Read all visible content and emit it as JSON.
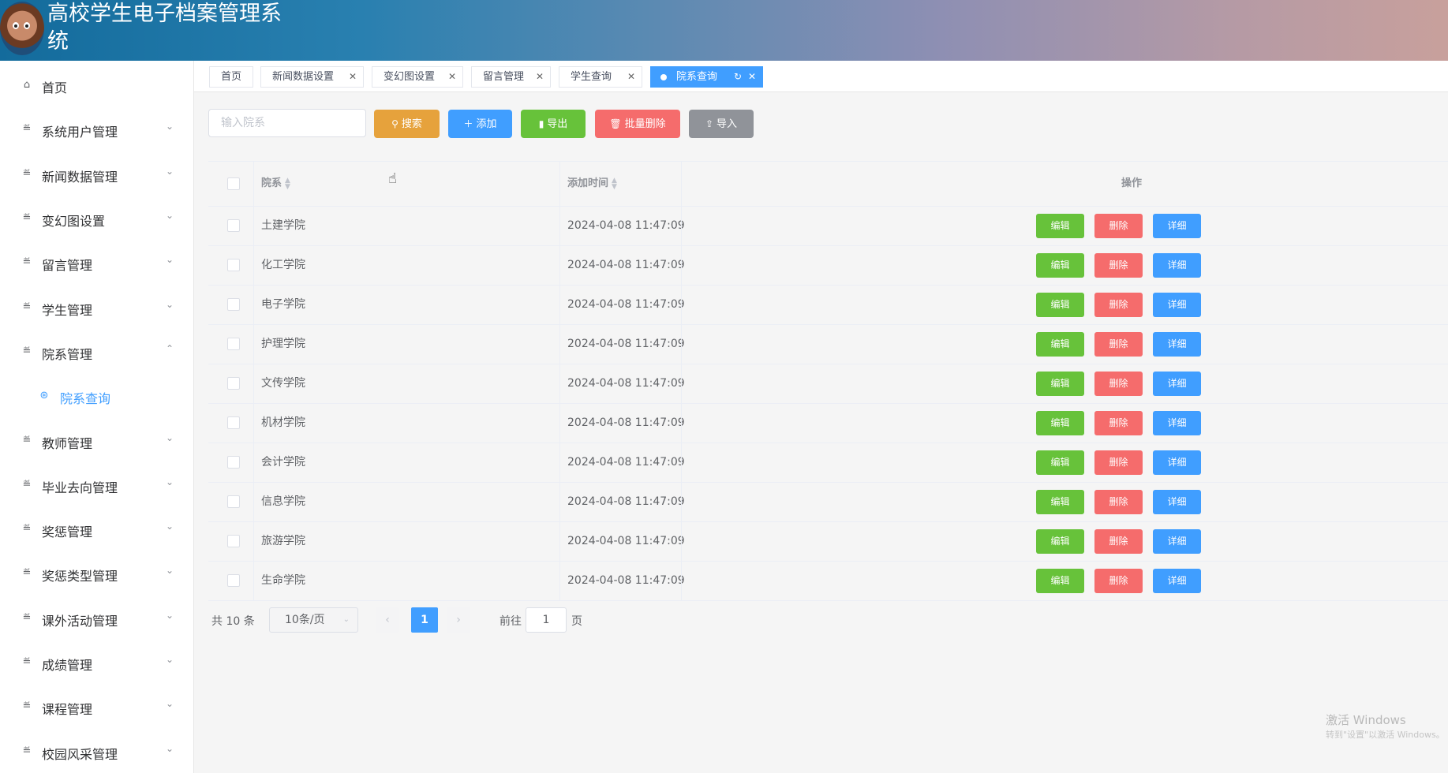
{
  "header": {
    "title": "高校学生电子档案管理系统"
  },
  "sidebar": {
    "items": [
      {
        "label": "首页",
        "icon": "home-icon",
        "arrow": ""
      },
      {
        "label": "系统用户管理",
        "icon": "menu-icon",
        "arrow": "⌄"
      },
      {
        "label": "新闻数据管理",
        "icon": "menu-icon",
        "arrow": "⌄"
      },
      {
        "label": "变幻图设置",
        "icon": "menu-icon",
        "arrow": "⌄"
      },
      {
        "label": "留言管理",
        "icon": "menu-icon",
        "arrow": "⌄"
      },
      {
        "label": "学生管理",
        "icon": "menu-icon",
        "arrow": "⌄"
      },
      {
        "label": "院系管理",
        "icon": "menu-icon",
        "arrow": "⌃"
      },
      {
        "label": "院系查询",
        "icon": "basketball-icon",
        "arrow": ""
      },
      {
        "label": "教师管理",
        "icon": "menu-icon",
        "arrow": "⌄"
      },
      {
        "label": "毕业去向管理",
        "icon": "menu-icon",
        "arrow": "⌄"
      },
      {
        "label": "奖惩管理",
        "icon": "menu-icon",
        "arrow": "⌄"
      },
      {
        "label": "奖惩类型管理",
        "icon": "menu-icon",
        "arrow": "⌄"
      },
      {
        "label": "课外活动管理",
        "icon": "menu-icon",
        "arrow": "⌄"
      },
      {
        "label": "成绩管理",
        "icon": "menu-icon",
        "arrow": "⌄"
      },
      {
        "label": "课程管理",
        "icon": "menu-icon",
        "arrow": "⌄"
      },
      {
        "label": "校园风采管理",
        "icon": "menu-icon",
        "arrow": "⌄"
      }
    ]
  },
  "tabs": [
    {
      "label": "首页",
      "closable": false,
      "active": false
    },
    {
      "label": "新闻数据设置",
      "closable": true,
      "active": false
    },
    {
      "label": "变幻图设置",
      "closable": true,
      "active": false
    },
    {
      "label": "留言管理",
      "closable": true,
      "active": false
    },
    {
      "label": "学生查询",
      "closable": true,
      "active": false
    },
    {
      "label": "院系查询",
      "closable": true,
      "active": true
    }
  ],
  "toolbar": {
    "search_placeholder": "输入院系",
    "search_label": "搜索",
    "add_label": "添加",
    "export_label": "导出",
    "batch_delete_label": "批量删除",
    "import_label": "导入"
  },
  "table": {
    "headers": {
      "dept": "院系",
      "time": "添加时间",
      "ops": "操作"
    },
    "rows": [
      {
        "dept": "土建学院",
        "time": "2024-04-08 11:47:09"
      },
      {
        "dept": "化工学院",
        "time": "2024-04-08 11:47:09"
      },
      {
        "dept": "电子学院",
        "time": "2024-04-08 11:47:09"
      },
      {
        "dept": "护理学院",
        "time": "2024-04-08 11:47:09"
      },
      {
        "dept": "文传学院",
        "time": "2024-04-08 11:47:09"
      },
      {
        "dept": "机材学院",
        "time": "2024-04-08 11:47:09"
      },
      {
        "dept": "会计学院",
        "time": "2024-04-08 11:47:09"
      },
      {
        "dept": "信息学院",
        "time": "2024-04-08 11:47:09"
      },
      {
        "dept": "旅游学院",
        "time": "2024-04-08 11:47:09"
      },
      {
        "dept": "生命学院",
        "time": "2024-04-08 11:47:09"
      }
    ],
    "ops": {
      "edit": "编辑",
      "delete": "删除",
      "detail": "详细"
    }
  },
  "pagination": {
    "total": "共 10 条",
    "page_size": "10条/页",
    "current": "1",
    "goto_label": "前往",
    "goto_value": "1",
    "page_suffix": "页"
  },
  "watermark": {
    "line1": "激活 Windows",
    "line2": "转到\"设置\"以激活 Windows。"
  },
  "colors": {
    "primary": "#409eff",
    "success": "#67c23a",
    "danger": "#f56c6c",
    "warning": "#e6a23c",
    "info": "#909399"
  }
}
